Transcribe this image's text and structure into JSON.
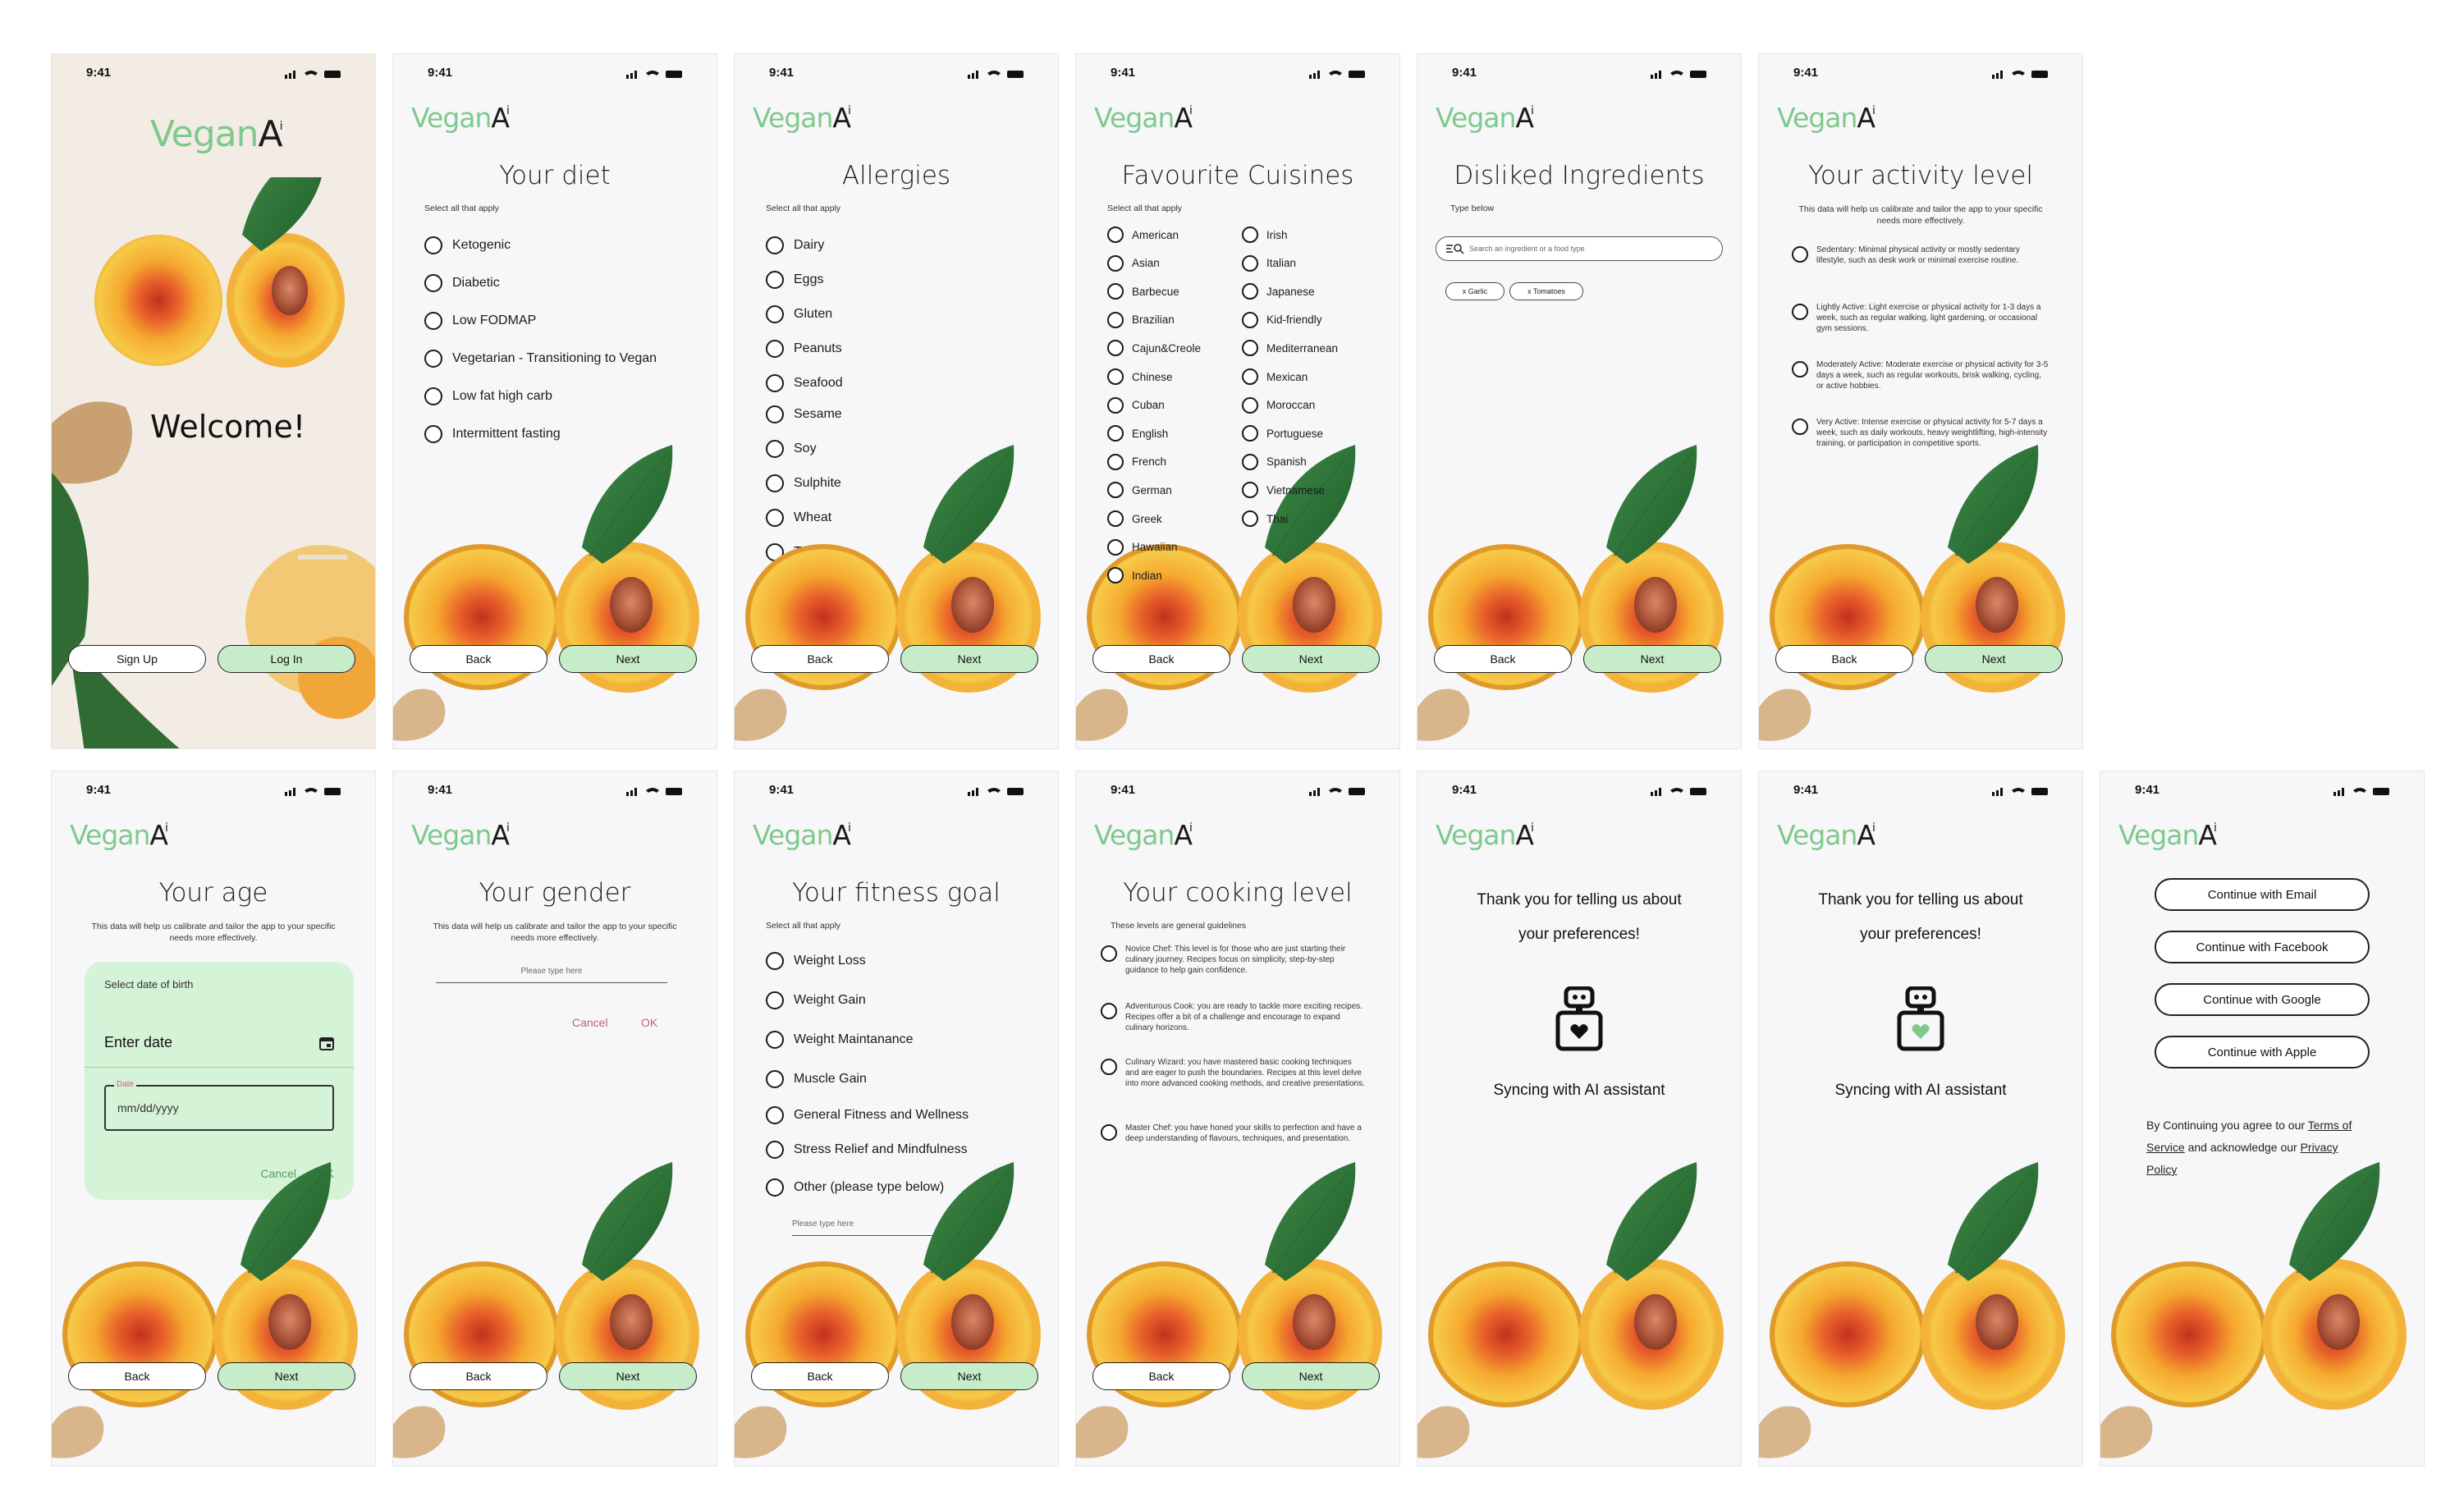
{
  "status": {
    "time": "9:41"
  },
  "logo": {
    "vegan": "Vegan",
    "ai": "A",
    "ai_mark": "i"
  },
  "colors": {
    "brand_green": "#7fc98c",
    "button_green": "#c6ecc9",
    "date_panel": "#d5f3d6",
    "ok_pink": "#c0627a"
  },
  "buttons": {
    "back": "Back",
    "next": "Next",
    "sign_up": "Sign Up",
    "log_in": "Log In"
  },
  "welcome": {
    "title": "Welcome!"
  },
  "diet": {
    "title": "Your diet",
    "hint": "Select all that apply",
    "options": [
      "Ketogenic",
      "Diabetic",
      "Low FODMAP",
      "Vegetarian - Transitioning to Vegan",
      "Low fat high carb",
      "Intermittent fasting"
    ]
  },
  "allergies": {
    "title": "Allergies",
    "hint": "Select all that apply",
    "options": [
      "Dairy",
      "Eggs",
      "Gluten",
      "Peanuts",
      "Seafood",
      "Sesame",
      "Soy",
      "Sulphite",
      "Wheat",
      "Tree-nuts"
    ]
  },
  "cuisines": {
    "title": "Favourite Cuisines",
    "hint": "Select all that apply",
    "left": [
      "American",
      "Asian",
      "Barbecue",
      "Brazilian",
      "Cajun&Creole",
      "Chinese",
      "Cuban",
      "English",
      "French",
      "German",
      "Greek",
      "Hawaiian",
      "Indian"
    ],
    "right": [
      "Irish",
      "Italian",
      "Japanese",
      "Kid-friendly",
      "Mediterranean",
      "Mexican",
      "Moroccan",
      "Portuguese",
      "Spanish",
      "Vietnamese",
      "Thai"
    ]
  },
  "disliked": {
    "title": "Disliked Ingredients",
    "hint": "Type below",
    "search_placeholder": "Search an ingredient or a food type",
    "chips": [
      "x Garlic",
      "x Tomatoes"
    ]
  },
  "activity": {
    "title": "Your activity level",
    "hint": "This data will help us calibrate and tailor the app to your specific needs more effectively.",
    "options": [
      "Sedentary: Minimal physical activity or mostly sedentary lifestyle, such as desk work or minimal exercise routine.",
      "Lightly Active: Light exercise or physical activity for 1-3 days a week, such as regular walking, light gardening, or occasional gym sessions.",
      "Moderately Active: Moderate exercise or physical activity for 3-5 days a week, such as regular workouts, brisk walking, cycling, or active hobbies.",
      "Very Active: Intense exercise or physical activity for 5-7 days a week, such as daily workouts, heavy weightlifting, high-intensity training, or participation in competitive sports."
    ]
  },
  "age": {
    "title": "Your age",
    "hint": "This data will help us calibrate and tailor the app to your specific needs more effectively.",
    "picker_label": "Select date of birth",
    "enter_date": "Enter date",
    "field_label": "Date",
    "field_placeholder": "mm/dd/yyyy",
    "cancel": "Cancel",
    "ok": "OK"
  },
  "gender": {
    "title": "Your gender",
    "hint": "This data will help us calibrate and tailor the app to your specific needs more effectively.",
    "placeholder": "Please type here",
    "cancel": "Cancel",
    "ok": "OK"
  },
  "fitness": {
    "title": "Your fitness goal",
    "hint": "Select all that apply",
    "options": [
      "Weight Loss",
      "Weight Gain",
      "Weight Maintanance",
      "Muscle Gain",
      "General Fitness and Wellness",
      "Stress Relief and Mindfulness",
      "Other (please type below)"
    ],
    "placeholder": "Please type here"
  },
  "cooking": {
    "title": "Your cooking level",
    "hint": "These levels are general guidelines",
    "options": [
      "Novice Chef: This level is for those who are just starting their culinary journey. Recipes focus on simplicity, step-by-step guidance to help gain confidence.",
      "Adventurous Cook: you are ready to tackle more exciting recipes. Recipes offer a bit of a challenge and encourage to expand culinary horizons.",
      "Culinary Wizard: you have mastered basic cooking techniques and are eager to push the boundaries. Recipes at this level delve into more advanced cooking methods, and creative presentations.",
      "Master Chef: you have honed your skills to perfection and have a deep understanding of flavours, techniques, and presentation."
    ]
  },
  "thanks": {
    "line1": "Thank you for telling us about",
    "line2": "your preferences!",
    "syncing": "Syncing with AI assistant"
  },
  "auth": {
    "options": [
      "Continue with Email",
      "Continue with Facebook",
      "Continue with Google",
      "Continue with Apple"
    ],
    "legal_prefix": "By Continuing you agree to our ",
    "terms_a": "Terms of",
    "terms_b": "Service",
    "legal_mid": " and acknowledge our ",
    "privacy_a": "Privacy",
    "privacy_b": "Policy"
  }
}
